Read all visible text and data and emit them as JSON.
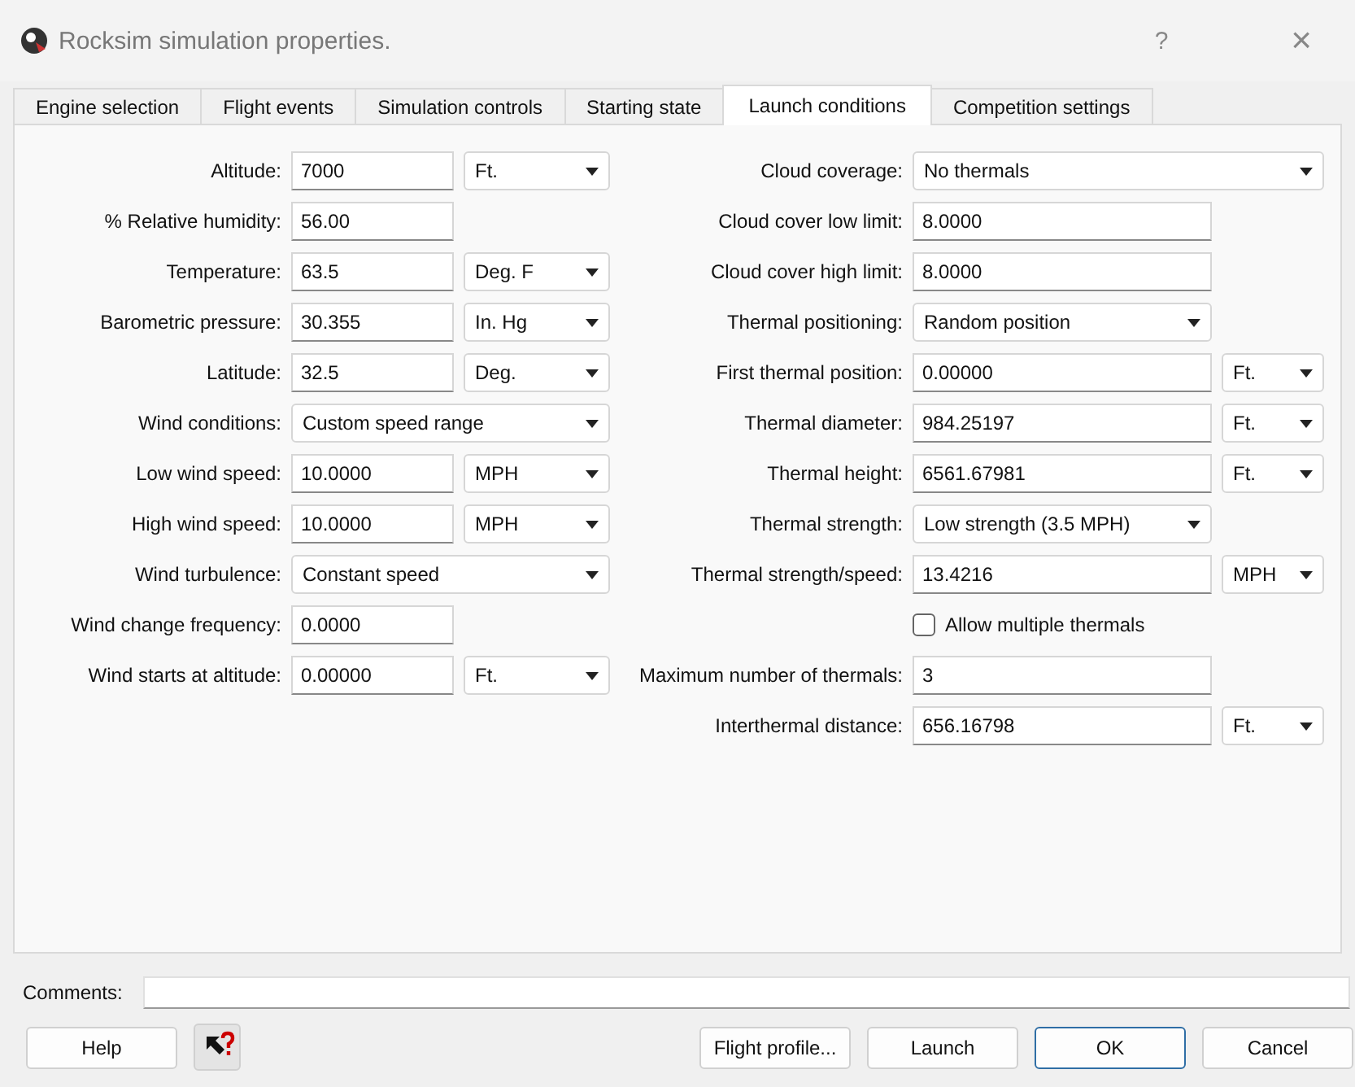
{
  "window": {
    "title": "Rocksim simulation properties.",
    "help_glyph": "?",
    "close_glyph": "×"
  },
  "tabs": [
    {
      "label": "Engine selection",
      "selected": false
    },
    {
      "label": "Flight events",
      "selected": false
    },
    {
      "label": "Simulation controls",
      "selected": false
    },
    {
      "label": "Starting state",
      "selected": false
    },
    {
      "label": "Launch conditions",
      "selected": true
    },
    {
      "label": "Competition settings",
      "selected": false
    }
  ],
  "left_fields": [
    {
      "kind": "field",
      "label": "Altitude:",
      "value": "7000",
      "unit": "Ft."
    },
    {
      "kind": "field",
      "label": "% Relative humidity:",
      "value": "56.00"
    },
    {
      "kind": "field",
      "label": "Temperature:",
      "value": "63.5",
      "unit": "Deg. F"
    },
    {
      "kind": "field",
      "label": "Barometric pressure:",
      "value": "30.355",
      "unit": "In. Hg"
    },
    {
      "kind": "field",
      "label": "Latitude:",
      "value": "32.5",
      "unit": "Deg."
    },
    {
      "kind": "wide_select",
      "label": "Wind conditions:",
      "value": "Custom speed range"
    },
    {
      "kind": "field",
      "label": "Low wind speed:",
      "value": "10.0000",
      "unit": "MPH"
    },
    {
      "kind": "field",
      "label": "High wind speed:",
      "value": "10.0000",
      "unit": "MPH"
    },
    {
      "kind": "wide_select",
      "label": "Wind turbulence:",
      "value": "Constant speed"
    },
    {
      "kind": "field",
      "label": "Wind change frequency:",
      "value": "0.0000"
    },
    {
      "kind": "field",
      "label": "Wind starts at altitude:",
      "value": "0.00000",
      "unit": "Ft."
    }
  ],
  "right_fields": [
    {
      "kind": "wide_select",
      "label": "Cloud coverage:",
      "value": "No thermals"
    },
    {
      "kind": "field",
      "label": "Cloud cover low limit:",
      "value": "8.0000"
    },
    {
      "kind": "field",
      "label": "Cloud cover high limit:",
      "value": "8.0000"
    },
    {
      "kind": "select",
      "label": "Thermal positioning:",
      "value": "Random position"
    },
    {
      "kind": "field",
      "label": "First thermal position:",
      "value": "0.00000",
      "unit": "Ft."
    },
    {
      "kind": "field",
      "label": "Thermal diameter:",
      "value": "984.25197",
      "unit": "Ft."
    },
    {
      "kind": "field",
      "label": "Thermal height:",
      "value": "6561.67981",
      "unit": "Ft."
    },
    {
      "kind": "select",
      "label": "Thermal strength:",
      "value": "Low strength (3.5 MPH)"
    },
    {
      "kind": "field",
      "label": "Thermal strength/speed:",
      "value": "13.4216",
      "unit": "MPH"
    },
    {
      "kind": "checkbox",
      "label": "Allow multiple thermals",
      "checked": false
    },
    {
      "kind": "field",
      "label": "Maximum number of thermals:",
      "value": "3"
    },
    {
      "kind": "field",
      "label": "Interthermal distance:",
      "value": "656.16798",
      "unit": "Ft."
    }
  ],
  "comments": {
    "label": "Comments:"
  },
  "buttons": [
    {
      "kind": "text",
      "label": "Help"
    },
    {
      "kind": "whats_this"
    },
    {
      "kind": "spacer"
    },
    {
      "kind": "text",
      "label": "Flight profile..."
    },
    {
      "kind": "text",
      "label": "Launch"
    },
    {
      "kind": "text",
      "label": "OK",
      "default": true
    },
    {
      "kind": "text",
      "label": "Cancel"
    }
  ]
}
